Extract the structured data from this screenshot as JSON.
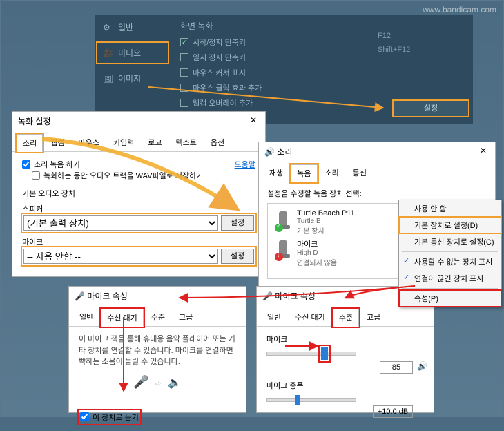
{
  "watermark": "www.bandicam.com",
  "bandicam": {
    "sidebar_general": "일반",
    "sidebar_video": "비디오",
    "sidebar_image": "이미지",
    "section_title": "화면 녹화",
    "row_start_hotkey": "시작/정지 단축키",
    "key_start": "F12",
    "row_pause_hotkey": "일시 정지 단축키",
    "key_pause": "Shift+F12",
    "row_mouse_cursor": "마우스 커서 표시",
    "row_mouse_click": "마우스 클릭 효과 추가",
    "row_webcam": "웹캠 오버레이 추가",
    "btn_settings": "설정"
  },
  "dlg1": {
    "title": "녹화 설정",
    "tabs": {
      "sound": "소리",
      "webcam": "웹캠",
      "mouse": "마우스",
      "key": "키입력",
      "logo": "로고",
      "text": "텍스트",
      "options": "옵션"
    },
    "help": "도움말",
    "chk_record_sound": "소리 녹음 하기",
    "chk_save_wav": "녹화하는 동안 오디오 트랙을 WAV파일로 저장하기",
    "group_label": "기본 오디오 장치",
    "label_speaker": "스피커",
    "val_speaker": "(기본 출력 장치)",
    "label_mic": "마이크",
    "val_mic": "-- 사용 안함 --",
    "btn_config": "설정"
  },
  "dlg2": {
    "title": "소리",
    "tabs": {
      "playback": "재생",
      "record": "녹음",
      "sound": "소리",
      "comm": "통신"
    },
    "instruction": "설정을 수정할 녹음 장치 선택:",
    "dev1": {
      "name": "Turtle Beach P11",
      "sub1": "Turtle B",
      "sub2": "기본 장치"
    },
    "dev2": {
      "name": "마이크",
      "sub1": "High D",
      "sub2": "연결되지 않음"
    },
    "ctx": {
      "disable": "사용 안 함",
      "set_default": "기본 장치로 설정(D)",
      "set_default_comm": "기본 통신 장치로 설정(C)",
      "show_disabled": "사용할 수 없는 장치 표시",
      "show_disconnected": "연결이 끊긴 장치 표시",
      "properties": "속성(P)"
    }
  },
  "dlg3": {
    "title": "마이크 속성",
    "tabs": {
      "general": "일반",
      "listen": "수신 대기",
      "levels": "수준",
      "advanced": "고급"
    },
    "desc": "이 마이크 잭을 통해 휴대용 음악 플레이어 또는 기타 장치를 연결할 수 있습니다. 마이크를 연결하면 빡하는 소음이 들릴 수 있습니다.",
    "chk_listen": "이 장치로 듣기"
  },
  "dlg4": {
    "title": "마이크 속성",
    "tabs": {
      "general": "일반",
      "listen": "수신 대기",
      "levels": "수준",
      "advanced": "고급"
    },
    "label_mic": "마이크",
    "val_mic": "85",
    "label_boost": "마이크 증폭",
    "val_boost": "+10.0 dB"
  }
}
